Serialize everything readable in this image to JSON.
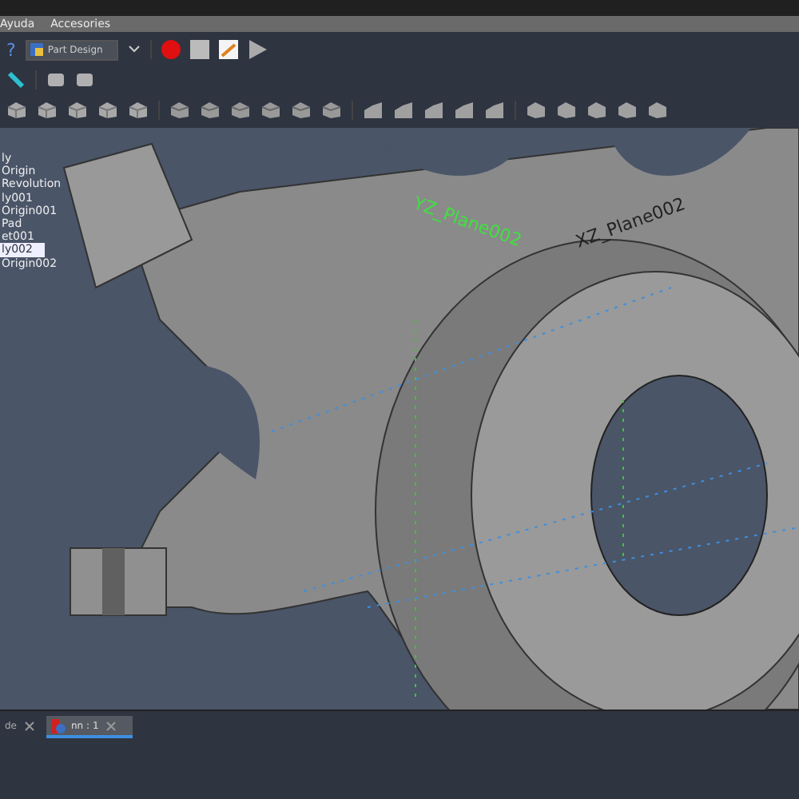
{
  "menu_bar": {
    "items": [
      "Ayuda",
      "Accesories"
    ]
  },
  "toolbar": {
    "workbench": "Part Design",
    "help": "?"
  },
  "tree": {
    "items": [
      {
        "label": "ly",
        "selected": false
      },
      {
        "label": "Origin",
        "selected": false
      },
      {
        "label": "Revolution",
        "selected": false
      },
      {
        "label": "ly001",
        "selected": false
      },
      {
        "label": "Origin001",
        "selected": false
      },
      {
        "label": "Pad",
        "selected": false
      },
      {
        "label": "et001",
        "selected": false
      },
      {
        "label": "ly002",
        "selected": true
      },
      {
        "label": "Origin002",
        "selected": false
      }
    ]
  },
  "viewport": {
    "labels": [
      {
        "text": "YZ_Plane002",
        "kind": "active"
      },
      {
        "text": "XZ_Plane002",
        "kind": "mirrored"
      }
    ]
  },
  "document_tabs": [
    {
      "label": "de",
      "selected": false
    },
    {
      "label": "nn : 1",
      "selected": true
    }
  ]
}
